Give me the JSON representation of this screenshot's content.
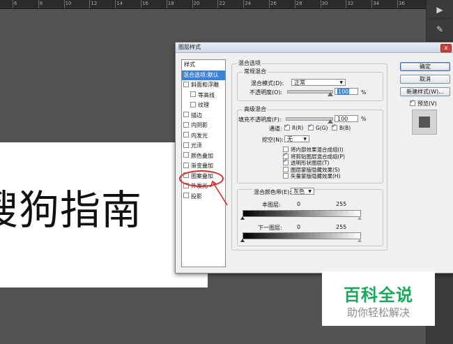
{
  "ruler": {
    "numbers": [
      "6",
      "8",
      "10",
      "12",
      "14",
      "16",
      "18",
      "20",
      "22",
      "24",
      "26",
      "28",
      "30",
      "32",
      "34",
      "36"
    ]
  },
  "canvas": {
    "text": "搜狗指南"
  },
  "dialog": {
    "title": "图层样式",
    "close_label": "x",
    "styles_header": "样式",
    "styles": [
      {
        "label": "混合选项:默认",
        "selected": true,
        "checkbox": false
      },
      {
        "label": "斜面和浮雕",
        "checkbox": true,
        "checked": false
      },
      {
        "label": "等高线",
        "checkbox": true,
        "checked": false,
        "indent": true
      },
      {
        "label": "纹理",
        "checkbox": true,
        "checked": false,
        "indent": true
      },
      {
        "label": "描边",
        "checkbox": true,
        "checked": false
      },
      {
        "label": "内阴影",
        "checkbox": true,
        "checked": false
      },
      {
        "label": "内发光",
        "checkbox": true,
        "checked": false
      },
      {
        "label": "光泽",
        "checkbox": true,
        "checked": false
      },
      {
        "label": "颜色叠加",
        "checkbox": true,
        "checked": false
      },
      {
        "label": "渐变叠加",
        "checkbox": true,
        "checked": false
      },
      {
        "label": "图案叠加",
        "checkbox": true,
        "checked": false
      },
      {
        "label": "外发光",
        "checkbox": true,
        "checked": false
      },
      {
        "label": "投影",
        "checkbox": true,
        "checked": false
      }
    ],
    "blend_options_title": "混合选项",
    "general_blend": {
      "title": "常规混合",
      "mode_label": "混合模式(D):",
      "mode_value": "正常",
      "opacity_label": "不透明度(O):",
      "opacity_value": "100",
      "percent": "%"
    },
    "advanced_blend": {
      "title": "高级混合",
      "fill_label": "填充不透明度(F):",
      "fill_value": "100",
      "percent": "%",
      "channels_label": "通道:",
      "channels": [
        "R(R)",
        "G(G)",
        "B(B)"
      ],
      "knockout_label": "挖空(N):",
      "knockout_value": "无",
      "options": [
        {
          "label": "将内部效果混合成组(I)",
          "checked": false
        },
        {
          "label": "将剪贴图层混合成组(P)",
          "checked": true
        },
        {
          "label": "透明形状图层(T)",
          "checked": true
        },
        {
          "label": "图层蒙版隐藏效果(S)",
          "checked": false
        },
        {
          "label": "矢量蒙版隐藏效果(H)",
          "checked": false
        }
      ]
    },
    "blend_if": {
      "label": "混合颜色带(E):",
      "value": "灰色",
      "this_layer_label": "本图层:",
      "this_layer_min": "0",
      "this_layer_max": "255",
      "under_layer_label": "下一图层:",
      "under_layer_min": "0",
      "under_layer_max": "255"
    },
    "buttons": {
      "ok": "确定",
      "cancel": "取消",
      "new_style": "新建样式(W)...",
      "preview": "预览(V)"
    }
  },
  "watermark": {
    "title": "百科全说",
    "subtitle": "助你轻松解决"
  },
  "colors": {
    "accent": "#3b82d6",
    "annotation": "#d6262b",
    "watermark_green": "#1aa85a"
  }
}
